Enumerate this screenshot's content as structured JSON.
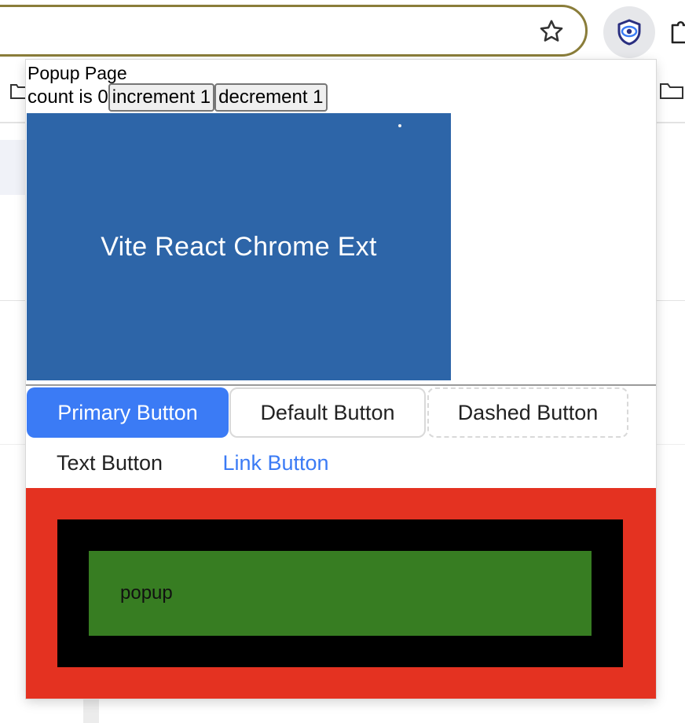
{
  "browser": {
    "star_icon": "star-icon",
    "extension_icon": "shield-eye-icon",
    "puzzle_icon": "puzzle-icon",
    "bookmark_folder_icon": "folder-icon"
  },
  "popup": {
    "title": "Popup Page",
    "counter": {
      "text": "count is 0",
      "increment_label": "increment 1",
      "decrement_label": "decrement 1"
    },
    "logo": {
      "text": "Vite React Chrome Ext",
      "background_color": "#2d65a8"
    },
    "buttons": {
      "primary": "Primary Button",
      "default": "Default Button",
      "dashed": "Dashed Button",
      "text": "Text Button",
      "link": "Link Button"
    },
    "nested_boxes": {
      "outer_color": "#e43221",
      "middle_color": "#000000",
      "inner_color": "#377d22",
      "label": "popup"
    },
    "accent_color": "#3b7bf5"
  }
}
